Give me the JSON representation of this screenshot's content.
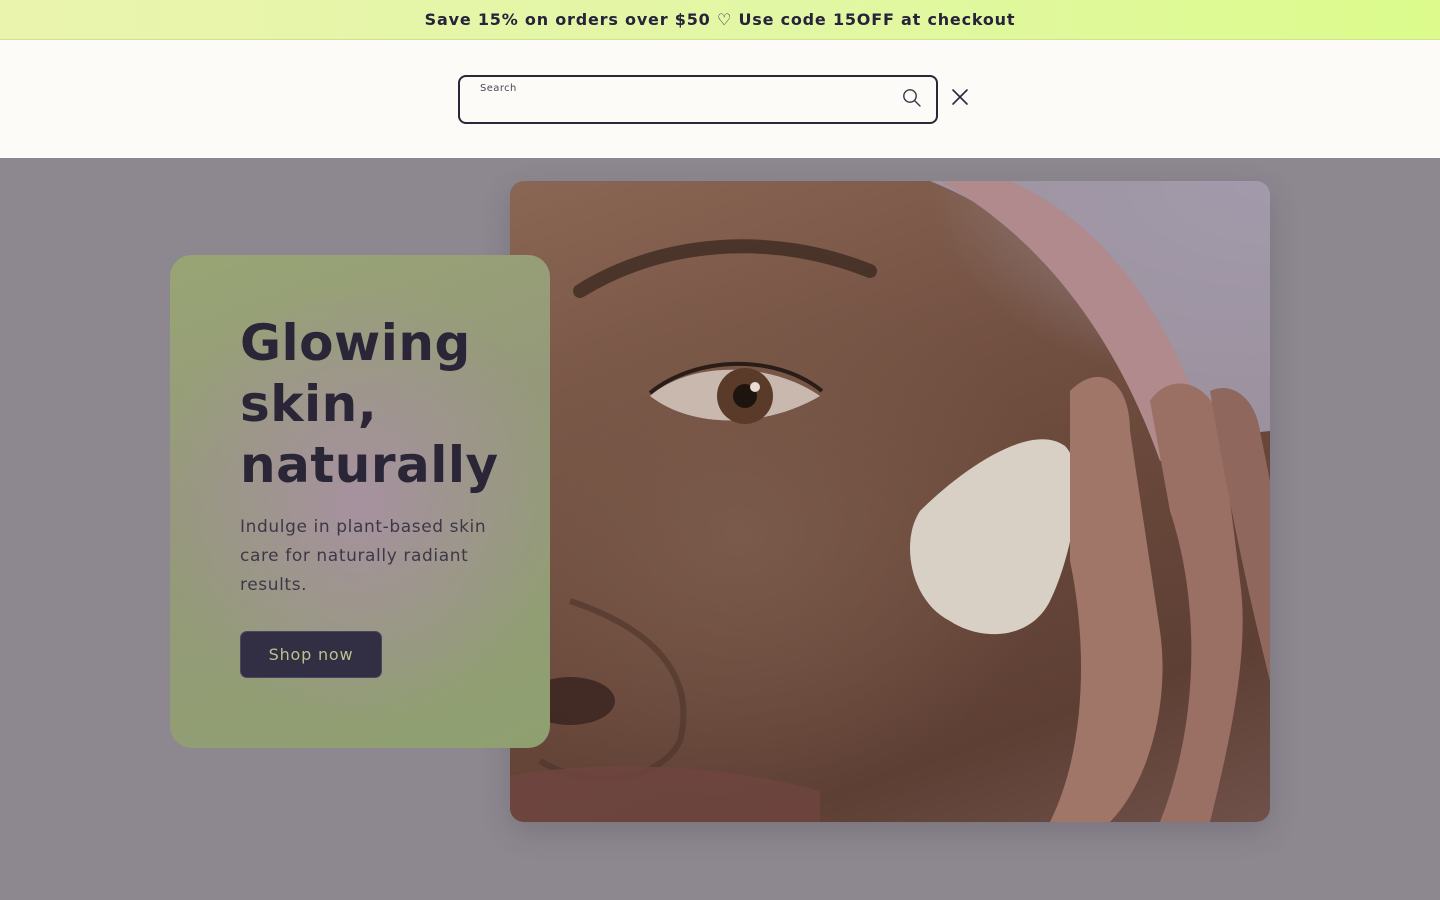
{
  "announcement": {
    "text": "Save 15% on orders over $50 ♡ Use code 15OFF at checkout"
  },
  "search": {
    "label": "Search",
    "value": "",
    "placeholder": "",
    "search_icon": "search-icon",
    "close_icon": "close-icon"
  },
  "hero": {
    "title": "Glowing skin, naturally",
    "subtitle": "Indulge in plant-based skin care for naturally radiant results.",
    "button_label": "Shop now"
  },
  "colors": {
    "announcement_bg": "#e2f7a4",
    "header_bg": "#fcfbf8",
    "overlay_bg": "#8d8890",
    "text_dark": "#2a2638",
    "button_bg": "#322e44",
    "button_text": "#b9c38c"
  }
}
